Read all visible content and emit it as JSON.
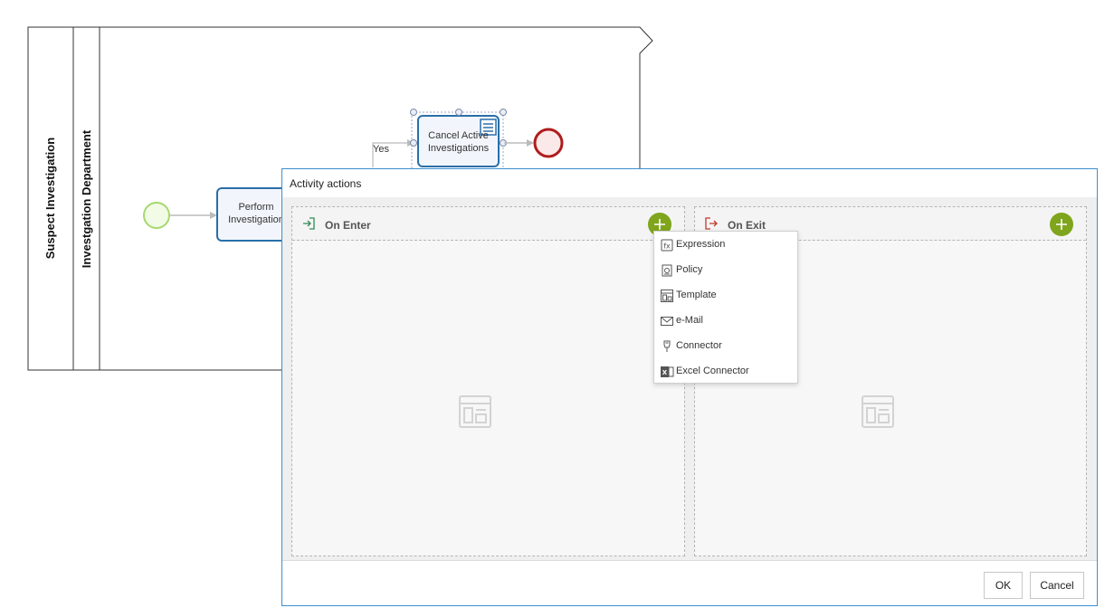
{
  "diagram": {
    "pool_label": "Suspect Investigation",
    "lane_label": "Investgation Department",
    "task_perform": "Perform Investigation",
    "task_cancel_line1": "Cancel Active",
    "task_cancel_line2": "Investigations",
    "gateway_yes": "Yes"
  },
  "dialog": {
    "title": "Activity actions",
    "on_enter": {
      "title": "On Enter"
    },
    "on_exit": {
      "title": "On Exit"
    },
    "ok_label": "OK",
    "cancel_label": "Cancel"
  },
  "menu": {
    "items": [
      {
        "label": "Expression",
        "icon": "expression-icon"
      },
      {
        "label": "Policy",
        "icon": "policy-icon"
      },
      {
        "label": "Template",
        "icon": "template-icon"
      },
      {
        "label": "e-Mail",
        "icon": "email-icon"
      },
      {
        "label": "Connector",
        "icon": "connector-icon"
      },
      {
        "label": "Excel Connector",
        "icon": "excel-icon"
      }
    ]
  },
  "colors": {
    "accent_blue": "#3d8fd1",
    "add_green": "#7ea51c",
    "start_event": "#a6d86e",
    "end_event": "#b01c1c",
    "task_border": "#2a6fa8"
  }
}
